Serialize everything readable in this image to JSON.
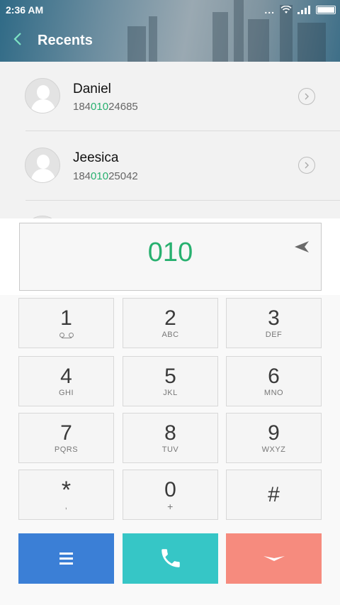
{
  "status_bar": {
    "time": "2:36 AM",
    "more": "...",
    "icons": [
      "wifi-icon",
      "signal-icon",
      "battery-icon"
    ]
  },
  "header": {
    "title": "Recents",
    "back_icon": "chevron-left-icon"
  },
  "recents": [
    {
      "name": "Daniel",
      "number_prefix": "184",
      "number_match": "010",
      "number_suffix": "24685"
    },
    {
      "name": "Jeesica",
      "number_prefix": "184",
      "number_match": "010",
      "number_suffix": "25042"
    }
  ],
  "dial_input": {
    "value": "010",
    "send_icon": "send-arrow-icon"
  },
  "keypad": [
    {
      "digit": "1",
      "letters": ""
    },
    {
      "digit": "2",
      "letters": "ABC"
    },
    {
      "digit": "3",
      "letters": "DEF"
    },
    {
      "digit": "4",
      "letters": "GHI"
    },
    {
      "digit": "5",
      "letters": "JKL"
    },
    {
      "digit": "6",
      "letters": "MNO"
    },
    {
      "digit": "7",
      "letters": "PQRS"
    },
    {
      "digit": "8",
      "letters": "TUV"
    },
    {
      "digit": "9",
      "letters": "WXYZ"
    },
    {
      "digit": "*",
      "letters": ","
    },
    {
      "digit": "0",
      "letters": "+"
    },
    {
      "digit": "#",
      "letters": ""
    }
  ],
  "actions": {
    "menu_icon": "menu-icon",
    "call_icon": "phone-icon",
    "hide_icon": "chevron-down-icon"
  },
  "colors": {
    "accent_green": "#27b06f",
    "menu_blue": "#3b7fd6",
    "call_teal": "#36c6c6",
    "hide_salmon": "#f68b7e"
  }
}
